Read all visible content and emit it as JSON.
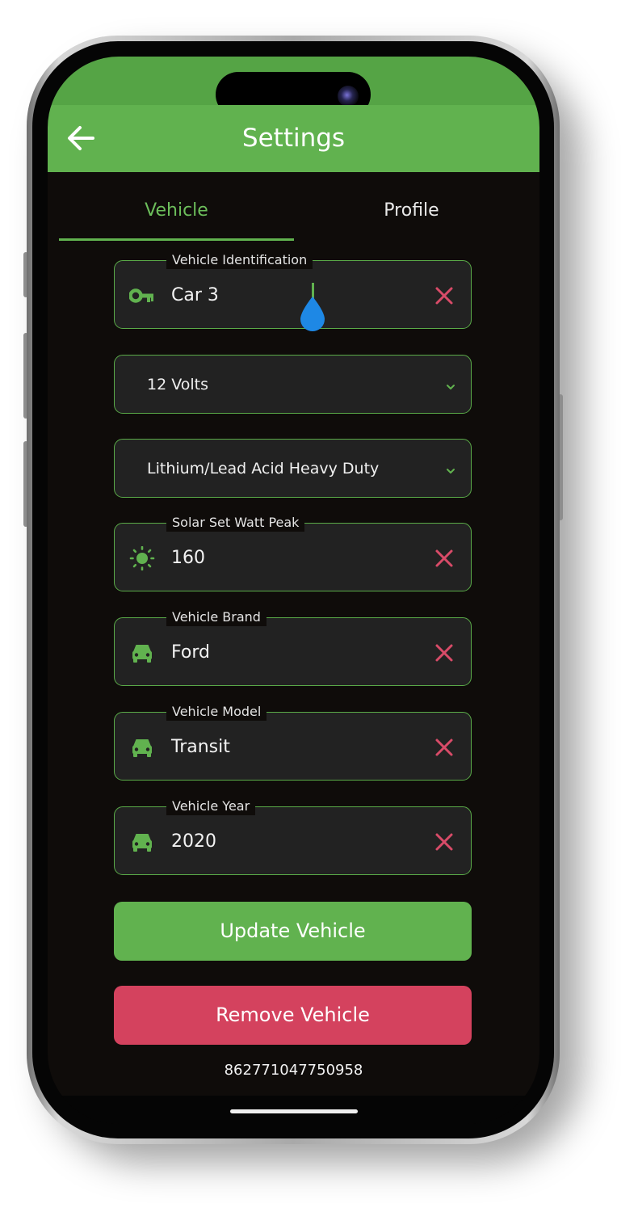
{
  "colors": {
    "accent_green": "#61b24f",
    "status_bar_green": "#55a445",
    "background": "#0f0c0a",
    "field_background": "#222222",
    "danger_red": "#d4425e",
    "clear_icon_red": "#d84b68",
    "cursor_blue": "#1e88e5"
  },
  "header": {
    "back_icon": "arrow-left-icon",
    "title": "Settings"
  },
  "tabs": [
    {
      "label": "Vehicle",
      "active": true
    },
    {
      "label": "Profile",
      "active": false
    }
  ],
  "form": {
    "vehicle_identification": {
      "label": "Vehicle Identification",
      "value": "Car 3",
      "icon": "key-icon",
      "clear_icon": "close-icon"
    },
    "voltage": {
      "value": "12 Volts",
      "icon": "chevron-down-icon"
    },
    "battery_type": {
      "value": "Lithium/Lead Acid Heavy Duty",
      "icon": "chevron-down-icon"
    },
    "solar_watt_peak": {
      "label": "Solar Set Watt Peak",
      "value": "160",
      "icon": "sun-icon",
      "clear_icon": "close-icon"
    },
    "vehicle_brand": {
      "label": "Vehicle Brand",
      "value": "Ford",
      "icon": "car-icon",
      "clear_icon": "close-icon"
    },
    "vehicle_model": {
      "label": "Vehicle Model",
      "value": "Transit",
      "icon": "car-icon",
      "clear_icon": "close-icon"
    },
    "vehicle_year": {
      "label": "Vehicle Year",
      "value": "2020",
      "icon": "car-icon",
      "clear_icon": "close-icon"
    }
  },
  "actions": {
    "update_label": "Update Vehicle",
    "remove_label": "Remove Vehicle"
  },
  "device_id": "862771047750958"
}
